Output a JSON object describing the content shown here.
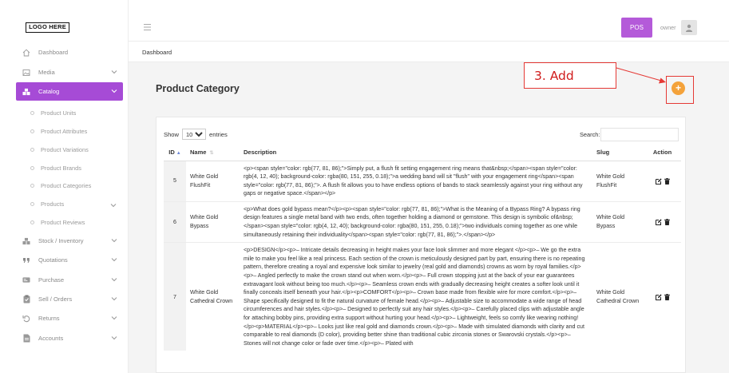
{
  "logo": {
    "text": "LOGO HERE"
  },
  "topbar": {
    "pos_label": "POS",
    "user_name": "owner"
  },
  "breadcrumb": {
    "label": "Dashboard"
  },
  "page": {
    "title": "Product Category"
  },
  "annotation": {
    "label": "3. Add"
  },
  "colors": {
    "accent": "#a64bd6",
    "pos_button": "#b45ad9",
    "add_button": "#f4a23a",
    "annotation": "#e53935"
  },
  "sidebar": {
    "items": [
      {
        "label": "Dashboard",
        "icon": "home-icon",
        "has_chevron": false
      },
      {
        "label": "Media",
        "icon": "image-icon",
        "has_chevron": true
      },
      {
        "label": "Catalog",
        "icon": "catalog-icon",
        "has_chevron": true,
        "active": true
      },
      {
        "label": "Stock / Inventory",
        "icon": "stock-icon",
        "has_chevron": true
      },
      {
        "label": "Quotations",
        "icon": "quote-icon",
        "has_chevron": true
      },
      {
        "label": "Purchase",
        "icon": "purchase-icon",
        "has_chevron": true
      },
      {
        "label": "Sell / Orders",
        "icon": "clipboard-icon",
        "has_chevron": true
      },
      {
        "label": "Returns",
        "icon": "undo-icon",
        "has_chevron": true
      },
      {
        "label": "Accounts",
        "icon": "document-icon",
        "has_chevron": true
      }
    ],
    "catalog_subitems": [
      {
        "label": "Product Units"
      },
      {
        "label": "Product Attributes"
      },
      {
        "label": "Product Variations"
      },
      {
        "label": "Product Brands"
      },
      {
        "label": "Product Categories"
      },
      {
        "label": "Products",
        "has_chevron": true
      },
      {
        "label": "Product Reviews"
      }
    ]
  },
  "table_controls": {
    "show_label": "Show",
    "entries_value": "10",
    "entries_label": "entries",
    "search_label": "Search:"
  },
  "table": {
    "columns": [
      "ID",
      "Name",
      "Description",
      "Slug",
      "Action"
    ],
    "rows": [
      {
        "id": "5",
        "name": "White Gold FlushFit",
        "description": "<p><span style=\"color: rgb(77, 81, 86);\">Simply put, a flush fit setting engagement ring means that&nbsp;</span><span style=\"color: rgb(4, 12, 40); background-color: rgba(80, 151, 255, 0.18);\">a wedding band will sit \"flush\" with your engagement ring</span><span style=\"color: rgb(77, 81, 86);\">. A flush fit allows you to have endless options of bands to stack seamlessly against your ring without any gaps or negative space.</span></p>",
        "slug": "White Gold FlushFit"
      },
      {
        "id": "6",
        "name": "White Gold Bypass",
        "description": "<p>What does gold bypass mean?</p><p><span style=\"color: rgb(77, 81, 86);\">What is the Meaning of a Bypass Ring? A bypass ring design features a single metal band with two ends, often together holding a diamond or gemstone. This design is symbolic of&nbsp;</span><span style=\"color: rgb(4, 12, 40); background-color: rgba(80, 151, 255, 0.18);\">two individuals coming together as one while simultaneously retaining their individuality</span><span style=\"color: rgb(77, 81, 86);\">.</span></p>",
        "slug": "White Gold Bypass"
      },
      {
        "id": "7",
        "name": "White Gold Cathedral Crown",
        "description": "<p>DESIGN</p><p>– Intricate details decreasing in height makes your face look slimmer and more elegant </p><p>– We go the extra mile to make you feel like a real princess. Each section of the crown is meticulously designed part by part, ensuring there is no repeating pattern, therefore creating a royal and expensive look similar to jewelry (real gold and diamonds) crowns as worn by royal families.</p><p>– Angled perfectly to make the crown stand out when worn.</p><p>– Full crown stopping just at the back of your ear guarantees extravagant look without being too much.</p><p>– Seamless crown ends with gradually decreasing height creates a softer look until it finally conceals itself beneath your hair.</p><p>COMFORT</p><p>– Crown base made from flexible wire for more comfort.</p><p>– Shape specifically designed to fit the natural curvature of female head.</p><p>– Adjustable size to accommodate a wide range of head circumferences and hair styles.</p><p>– Designed to perfectly suit any hair styles.</p><p>– Carefully placed clips with adjustable angle for attaching bobby pins, providing extra support without hurting your head.</p><p>– Lightweight, feels so comfy like wearing nothing!</p><p>MATERIAL</p><p>– Looks just like real gold and diamonds crown.</p><p>– Made with simulated diamonds with clarity and cut comparable to real diamonds (D color), providing better shine than traditional cubic zirconia stones or Swarovski crystals.</p><p>– Stones will not change color or fade over time.</p><p>– Plated with",
        "slug": "White Gold Cathedral Crown"
      }
    ]
  }
}
